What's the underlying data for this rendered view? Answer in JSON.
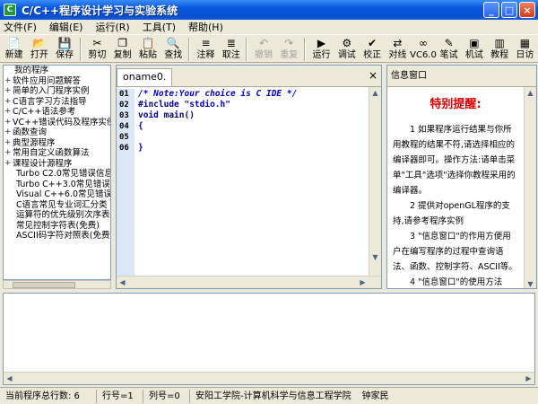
{
  "window": {
    "title": "C/C++程序设计学习与实验系统",
    "icon_text": "C"
  },
  "menu": [
    "文件(F)",
    "编辑(E)",
    "运行(R)",
    "工具(T)",
    "帮助(H)"
  ],
  "toolbar": [
    {
      "label": "新建",
      "icon": "new-file-icon",
      "glyph": "📄",
      "enabled": true
    },
    {
      "label": "打开",
      "icon": "open-folder-icon",
      "glyph": "📂",
      "enabled": true
    },
    {
      "label": "保存",
      "icon": "save-icon",
      "glyph": "💾",
      "enabled": true
    },
    {
      "sep": true
    },
    {
      "label": "剪切",
      "icon": "cut-icon",
      "glyph": "✂",
      "enabled": true
    },
    {
      "label": "复制",
      "icon": "copy-icon",
      "glyph": "❐",
      "enabled": true
    },
    {
      "label": "粘贴",
      "icon": "paste-icon",
      "glyph": "📋",
      "enabled": true
    },
    {
      "label": "查找",
      "icon": "find-icon",
      "glyph": "🔍",
      "enabled": true
    },
    {
      "sep": true
    },
    {
      "label": "注释",
      "icon": "comment-icon",
      "glyph": "≡",
      "enabled": true
    },
    {
      "label": "取注",
      "icon": "uncomment-icon",
      "glyph": "≣",
      "enabled": true
    },
    {
      "sep": true
    },
    {
      "label": "撤销",
      "icon": "undo-icon",
      "glyph": "↶",
      "enabled": false
    },
    {
      "label": "重复",
      "icon": "redo-icon",
      "glyph": "↷",
      "enabled": false
    },
    {
      "sep": true
    },
    {
      "label": "运行",
      "icon": "run-icon",
      "glyph": "▶",
      "enabled": true
    },
    {
      "label": "调试",
      "icon": "debug-icon",
      "glyph": "⚙",
      "enabled": true
    },
    {
      "label": "校正",
      "icon": "check-icon",
      "glyph": "✔",
      "enabled": true
    },
    {
      "label": "对线",
      "icon": "align-icon",
      "glyph": "⇄",
      "enabled": true
    },
    {
      "label": "VC6.0",
      "icon": "vc6-icon",
      "glyph": "∞",
      "enabled": true
    },
    {
      "label": "笔试",
      "icon": "pen-icon",
      "glyph": "✎",
      "enabled": true
    },
    {
      "label": "机试",
      "icon": "computer-icon",
      "glyph": "▣",
      "enabled": true
    },
    {
      "label": "教程",
      "icon": "book-icon",
      "glyph": "▥",
      "enabled": true
    },
    {
      "label": "日访",
      "icon": "calendar-icon",
      "glyph": "▦",
      "enabled": true
    }
  ],
  "tree": {
    "root": "我的程序",
    "items": [
      {
        "label": "软件应用问题解答",
        "expandable": true
      },
      {
        "label": "简单的入门程序实例",
        "expandable": true
      },
      {
        "label": "C语言学习方法指导",
        "expandable": true
      },
      {
        "label": "C/C++语法参考",
        "expandable": true
      },
      {
        "label": "VC++错误代码及程序实例",
        "expandable": true
      },
      {
        "label": "函数查询",
        "expandable": true
      },
      {
        "label": "典型源程序",
        "expandable": true
      },
      {
        "label": "常用自定义函数算法",
        "expandable": true
      },
      {
        "label": "课程设计源程序",
        "expandable": true
      },
      {
        "label": "Turbo C2.0常见错误信息",
        "expandable": false
      },
      {
        "label": "Turbo C++3.0常见错误",
        "expandable": false
      },
      {
        "label": "Visual C++6.0常见错误",
        "expandable": false
      },
      {
        "label": "C语言常见专业词汇分类",
        "expandable": false
      },
      {
        "label": "运算符的优先级别次序表",
        "expandable": false
      },
      {
        "label": "常见控制字符表(免费)",
        "expandable": false
      },
      {
        "label": "ASCII码字符对照表(免费)",
        "expandable": false
      }
    ]
  },
  "editor": {
    "tab_label": "oname0.",
    "close_glyph": "×",
    "line_numbers": [
      "01",
      "02",
      "03",
      "04",
      "05",
      "06"
    ],
    "lines": [
      {
        "text": "/* Note:Your choice is C IDE */",
        "kind": "comment"
      },
      {
        "text": "#include \"stdio.h\"",
        "kind": "include"
      },
      {
        "text": "void main()",
        "kind": "keyword"
      },
      {
        "text": "{",
        "kind": "keyword"
      },
      {
        "text": "",
        "kind": "keyword"
      },
      {
        "text": "}",
        "kind": "keyword"
      }
    ]
  },
  "info": {
    "header": "信息窗口",
    "title": "特别提醒:",
    "paragraphs": [
      "1 如果程序运行结果与你所用教程的结果不符,请选择相应的编译器即可。操作方法:请单击菜单\"工具\"选项\"选择你教程采用的编译器。",
      "2 提供对openGL程序的支持,请参考程序实例",
      "3 \"信息窗口\"的作用方便用户在编写程序的过程中查询语法、函数、控制字符、ASCII等。",
      "4 \"信息窗口\"的使用方法"
    ]
  },
  "status": {
    "total_lines": "当前程序总行数: 6",
    "row": "行号=1",
    "col": "列号=0",
    "org": "安阳工学院-计算机科学与信息工程学院",
    "author": "钟家民"
  }
}
